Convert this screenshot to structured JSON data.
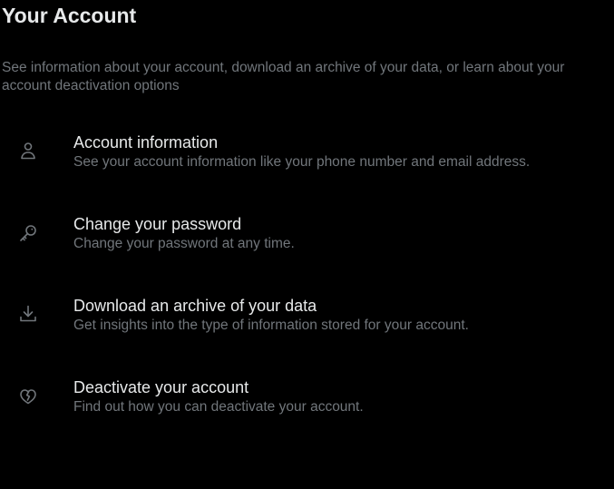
{
  "header": {
    "title": "Your Account",
    "description": "See information about your account, download an archive of your data, or learn about your account deactivation options"
  },
  "items": [
    {
      "label": "Account information",
      "sublabel": "See your account information like your phone number and email address.",
      "icon": "person-icon"
    },
    {
      "label": "Change your password",
      "sublabel": "Change your password at any time.",
      "icon": "key-icon"
    },
    {
      "label": "Download an archive of your data",
      "sublabel": "Get insights into the type of information stored for your account.",
      "icon": "download-icon"
    },
    {
      "label": "Deactivate your account",
      "sublabel": "Find out how you can deactivate your account.",
      "icon": "broken-heart-icon"
    }
  ],
  "colors": {
    "background": "#000000",
    "primary_text": "#e7e9ea",
    "secondary_text": "#71767b",
    "icon": "#71767b"
  }
}
